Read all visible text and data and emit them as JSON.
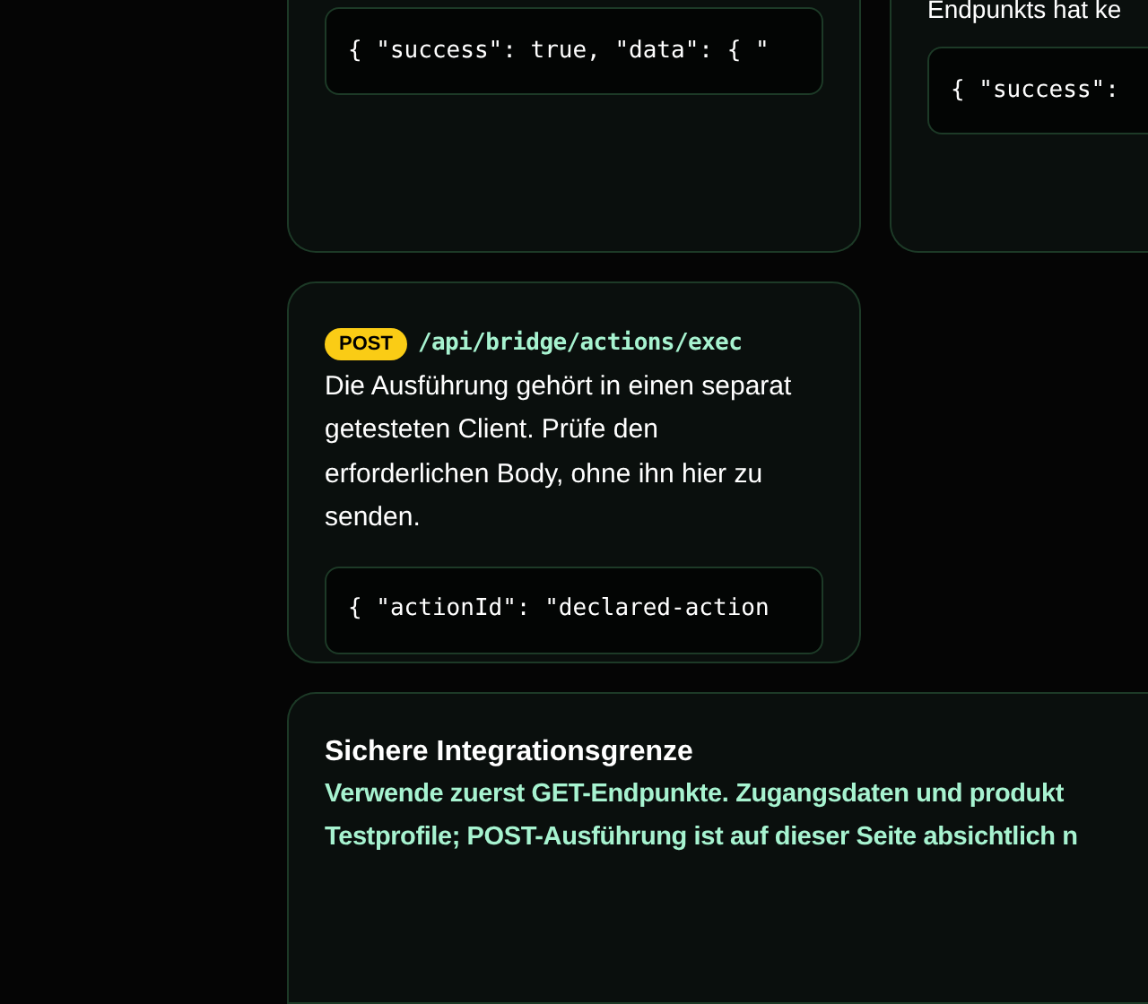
{
  "top_cards": [
    {
      "code": "{ \"success\": true, \"data\": { \""
    },
    {
      "text": "Endpunkts hat ke",
      "code": "{ \"success\":"
    }
  ],
  "endpoint": {
    "method": "POST",
    "path": "/api/bridge/actions/exec",
    "description": "Die Ausführung gehört in einen separat getesteten Client. Prüfe den erforderlichen Body, ohne ihn hier zu senden.",
    "code": "{ \"actionId\": \"declared-action"
  },
  "notice": {
    "title": "Sichere Integrationsgrenze",
    "lines": [
      "Verwende zuerst GET-Endpunkte. Zugangsdaten und produkt",
      "Testprofile; POST-Ausführung ist auf dieser Seite absichtlich n"
    ]
  }
}
